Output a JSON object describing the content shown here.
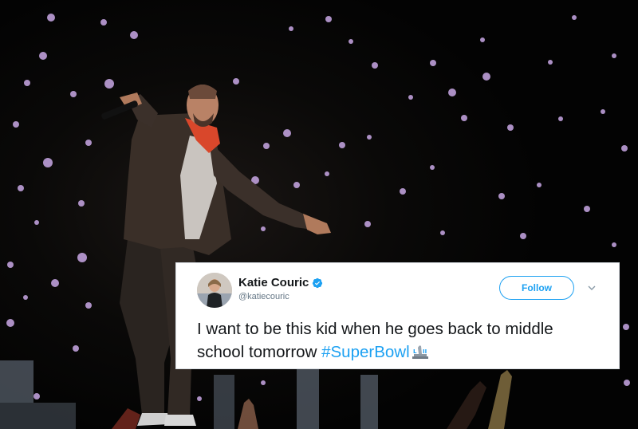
{
  "tweet": {
    "author_name": "Katie Couric",
    "author_handle": "@katiecouric",
    "follow_label": "Follow",
    "text": "I want to be this kid when he goes back to middle school tomorrow ",
    "hashtag": "#SuperBowl",
    "verified_icon": "verified-badge-icon",
    "menu_icon": "chevron-down-icon",
    "hashtag_icon": "trophy-icon"
  },
  "colors": {
    "twitter_blue": "#1da1f2",
    "text_primary": "#14171a",
    "text_secondary": "#657786",
    "card_background": "#ffffff"
  }
}
